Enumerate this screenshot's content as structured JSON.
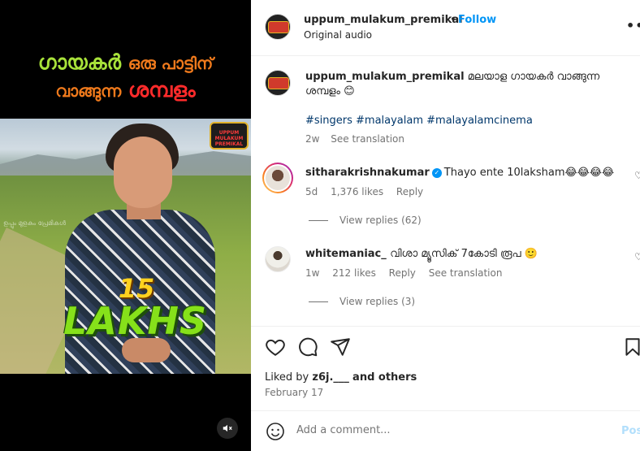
{
  "media": {
    "headline_line1_a": "ഗായകർ",
    "headline_line1_b": "ഒരു പാട്ടിന്",
    "headline_line2_a": "വാങ്ങുന്ന",
    "headline_line2_b": "ശമ്പളം",
    "badge_text": "UPPUM MULAKUM PREMIKAL",
    "watermark": "ഉപ്പും മുളകും പ്രേമികൾ",
    "amount_number": "15",
    "amount_unit": "LAKHS",
    "mute_icon": "speaker-muted-icon"
  },
  "header": {
    "username": "uppum_mulakum_premikal",
    "separator": "•",
    "follow_label": "Follow",
    "audio": "Original audio",
    "more_icon": "•••"
  },
  "caption": {
    "username": "uppum_mulakum_premikal",
    "text": "മലയാള ഗായകർ വാങ്ങുന്ന ശമ്പളം 😊",
    "hashtags": "#singers #malayalam #malayalamcinema",
    "age": "2w",
    "translate": "See translation"
  },
  "comments": [
    {
      "username": "sitharakrishnakumar",
      "verified": true,
      "text": "Thayo ente 10laksham😂😂😂😂",
      "age": "5d",
      "likes": "1,376 likes",
      "reply": "Reply",
      "view_replies": "View replies (62)"
    },
    {
      "username": "whitemaniac_",
      "verified": false,
      "text": "വിശാ മ്യൂസിക് 7കോടി രൂപ 🙂",
      "age": "1w",
      "likes": "212 likes",
      "reply": "Reply",
      "translate": "See translation",
      "view_replies": "View replies (3)"
    }
  ],
  "actions": {
    "like_icon": "heart-icon",
    "comment_icon": "comment-icon",
    "share_icon": "share-icon",
    "save_icon": "bookmark-icon"
  },
  "likes": {
    "prefix": "Liked by",
    "user": "z6j.___",
    "suffix": "and others"
  },
  "date": "February 17",
  "add_comment": {
    "placeholder": "Add a comment...",
    "post_label": "Post"
  },
  "colors": {
    "accent": "#0095f6",
    "muted": "#737373"
  }
}
